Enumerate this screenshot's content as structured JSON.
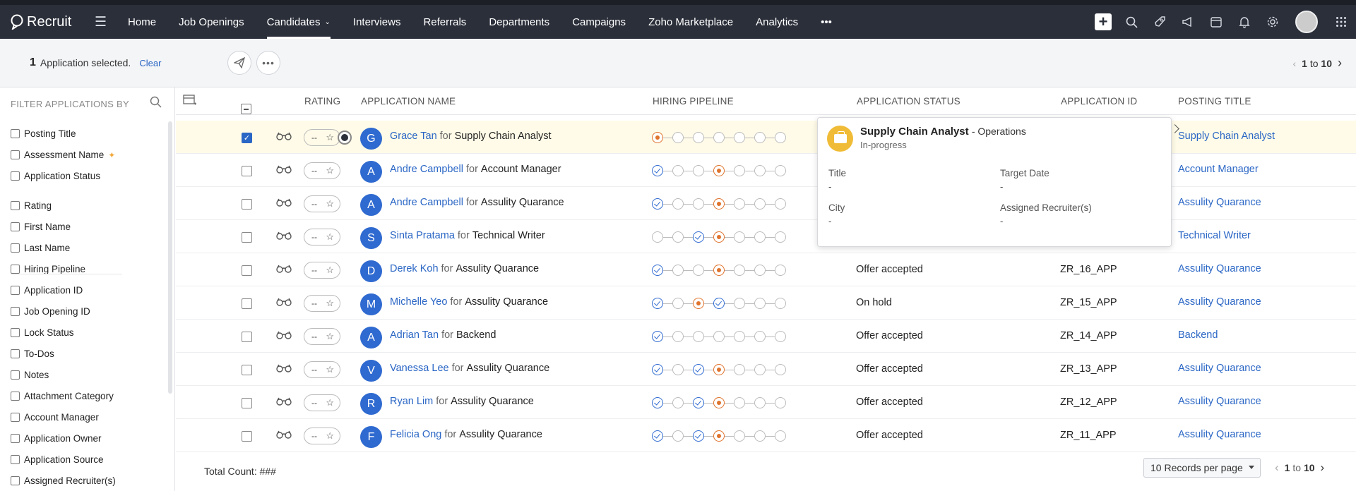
{
  "app": {
    "name": "Recruit"
  },
  "nav": {
    "items": [
      {
        "label": "Home"
      },
      {
        "label": "Job Openings"
      },
      {
        "label": "Candidates"
      },
      {
        "label": "Interviews"
      },
      {
        "label": "Referrals"
      },
      {
        "label": "Departments"
      },
      {
        "label": "Campaigns"
      },
      {
        "label": "Zoho Marketplace"
      },
      {
        "label": "Analytics"
      }
    ],
    "more": "•••"
  },
  "selection": {
    "count": "1",
    "text": "Application selected.",
    "clear": "Clear"
  },
  "pager": {
    "from": "1",
    "to_word": "to",
    "to": "10"
  },
  "filters": {
    "heading": "FILTER APPLICATIONS BY",
    "items": [
      "Posting Title",
      "Assessment Name",
      "Application Status",
      "Rating",
      "First Name",
      "Last Name",
      "Hiring Pipeline",
      "Application ID",
      "Job Opening ID",
      "Lock Status",
      "To-Dos",
      "Notes",
      "Attachment Category",
      "Account Manager",
      "Application Owner",
      "Application Source",
      "Assigned Recruiter(s)"
    ]
  },
  "columns": {
    "rating": "RATING",
    "app_name": "APPLICATION NAME",
    "pipeline": "HIRING PIPELINE",
    "status": "APPLICATION STATUS",
    "app_id": "APPLICATION ID",
    "posting": "POSTING TITLE"
  },
  "rows": [
    {
      "initial": "G",
      "name": "Grace Tan",
      "for": "for",
      "job": "Supply Chain Analyst",
      "rating": "--",
      "status": "",
      "app_id": "",
      "posting": "Supply Chain Analyst",
      "pipeline": [
        "cur",
        "e",
        "e",
        "e",
        "e",
        "e",
        "e"
      ]
    },
    {
      "initial": "A",
      "name": "Andre Campbell",
      "for": "for",
      "job": "Account Manager",
      "rating": "--",
      "status": "",
      "app_id": "",
      "posting": "Account Manager",
      "pipeline": [
        "done",
        "e",
        "e",
        "cur",
        "e",
        "e",
        "e"
      ]
    },
    {
      "initial": "A",
      "name": "Andre Campbell",
      "for": "for",
      "job": "Assulity Quarance",
      "rating": "--",
      "status": "",
      "app_id": "",
      "posting": "Assulity Quarance",
      "pipeline": [
        "done",
        "e",
        "e",
        "cur",
        "e",
        "e",
        "e"
      ]
    },
    {
      "initial": "S",
      "name": "Sinta Pratama",
      "for": "for",
      "job": "Technical Writer",
      "rating": "--",
      "status": "",
      "app_id": "",
      "posting": "Technical Writer",
      "pipeline": [
        "e",
        "e",
        "done",
        "cur",
        "e",
        "e",
        "e"
      ]
    },
    {
      "initial": "D",
      "name": "Derek Koh",
      "for": "for",
      "job": "Assulity Quarance",
      "rating": "--",
      "status": "Offer accepted",
      "app_id": "ZR_16_APP",
      "posting": "Assulity Quarance",
      "pipeline": [
        "done",
        "e",
        "e",
        "cur",
        "e",
        "e",
        "e"
      ]
    },
    {
      "initial": "M",
      "name": "Michelle Yeo",
      "for": "for",
      "job": "Assulity Quarance",
      "rating": "--",
      "status": "On hold",
      "app_id": "ZR_15_APP",
      "posting": "Assulity Quarance",
      "pipeline": [
        "done",
        "e",
        "cur",
        "done",
        "e",
        "e",
        "e"
      ]
    },
    {
      "initial": "A",
      "name": "Adrian Tan",
      "for": "for",
      "job": "Backend",
      "rating": "--",
      "status": "Offer accepted",
      "app_id": "ZR_14_APP",
      "posting": "Backend",
      "pipeline": [
        "done",
        "e",
        "e",
        "e",
        "e",
        "e",
        "e"
      ]
    },
    {
      "initial": "V",
      "name": "Vanessa Lee",
      "for": "for",
      "job": "Assulity Quarance",
      "rating": "--",
      "status": "Offer accepted",
      "app_id": "ZR_13_APP",
      "posting": "Assulity Quarance",
      "pipeline": [
        "done",
        "e",
        "done",
        "cur",
        "e",
        "e",
        "e"
      ]
    },
    {
      "initial": "R",
      "name": "Ryan Lim",
      "for": "for",
      "job": "Assulity Quarance",
      "rating": "--",
      "status": "Offer accepted",
      "app_id": "ZR_12_APP",
      "posting": "Assulity Quarance",
      "pipeline": [
        "done",
        "e",
        "done",
        "cur",
        "e",
        "e",
        "e"
      ]
    },
    {
      "initial": "F",
      "name": "Felicia Ong",
      "for": "for",
      "job": "Assulity Quarance",
      "rating": "--",
      "status": "Offer accepted",
      "app_id": "ZR_11_APP",
      "posting": "Assulity Quarance",
      "pipeline": [
        "done",
        "e",
        "done",
        "cur",
        "e",
        "e",
        "e"
      ]
    }
  ],
  "popover": {
    "title": "Supply Chain Analyst",
    "dept": "- Operations",
    "status": "In-progress",
    "fields": [
      {
        "label": "Title",
        "value": "-"
      },
      {
        "label": "Target Date",
        "value": "-"
      },
      {
        "label": "City",
        "value": "-"
      },
      {
        "label": "Assigned Recruiter(s)",
        "value": "-"
      }
    ]
  },
  "footer": {
    "total": "Total Count: ###",
    "records": "10 Records per page",
    "from": "1",
    "to_word": "to",
    "to": "10"
  },
  "colors": {
    "topbar": "#2b2f3a",
    "link": "#2a66c5",
    "avatar": "#2f6ad0",
    "pipeline_current": "#e0732d",
    "selected_row": "#fffbe8"
  }
}
